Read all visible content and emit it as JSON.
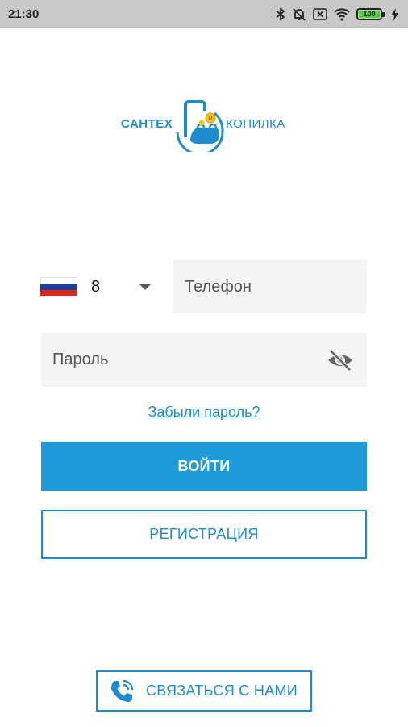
{
  "status_bar": {
    "time": "21:30",
    "battery_level": "100",
    "icons": [
      "bluetooth-icon",
      "notifications-off-icon",
      "sim-off-icon",
      "wifi-icon",
      "battery-icon",
      "charging-icon"
    ]
  },
  "logo": {
    "left_text": "САНТЕХ",
    "right_text": "КОПИЛКА"
  },
  "phone": {
    "country_code": "8",
    "country_flag": "russia-flag",
    "placeholder": "Телефон"
  },
  "password": {
    "placeholder": "Пароль",
    "toggle_icon": "eye-off-icon"
  },
  "forgot_password": "Забыли пароль?",
  "login_label": "ВОЙТИ",
  "register_label": "РЕГИСТРАЦИЯ",
  "contact": {
    "label": "СВЯЗАТЬСЯ С НАМИ",
    "icon": "phone-call-icon"
  },
  "colors": {
    "accent": "#1e8ccc",
    "primary_button": "#1e9ad8",
    "field_background": "#f4f4f4",
    "status_bar": "#c9c9c9"
  }
}
